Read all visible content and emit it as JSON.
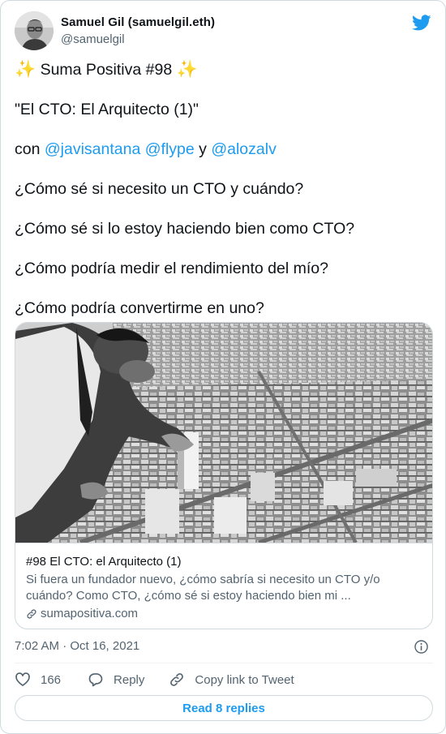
{
  "author": {
    "name": "Samuel Gil (samuelgil.eth)",
    "handle": "@samuelgil"
  },
  "tweet": {
    "line1_prefix": "✨",
    "line1_text": " Suma Positiva #98 ",
    "line1_suffix": "✨",
    "line2": "\"El CTO: El Arquitecto (1)\"",
    "line3_con": "con ",
    "mention1": "@javisantana",
    "mention2": "@flype",
    "line3_y": " y ",
    "mention3": "@alozalv",
    "q1": "¿Cómo sé si necesito un CTO y cuándo?",
    "q2": "¿Cómo sé si lo estoy haciendo bien como CTO?",
    "q3": "¿Cómo podría medir el rendimiento del mío?",
    "q4": "¿Cómo podría convertirme en uno?"
  },
  "link_card": {
    "title": "#98 El CTO: el Arquitecto (1)",
    "description": "Si fuera un fundador nuevo, ¿cómo sabría si necesito un CTO y/o cuándo? Como CTO, ¿cómo sé si estoy haciendo bien mi ...",
    "domain": "sumapositiva.com"
  },
  "timestamp": "7:02 AM · Oct 16, 2021",
  "actions": {
    "like_count": "166",
    "reply_label": "Reply",
    "copy_label": "Copy link to Tweet"
  },
  "read_replies_label": "Read 8 replies",
  "icons": [
    "twitter-bird-icon",
    "info-icon",
    "heart-icon",
    "reply-icon",
    "link-icon"
  ],
  "colors": {
    "accent": "#1d9bf0",
    "text": "#0f1419",
    "muted": "#536471",
    "border": "#cfd9de"
  }
}
